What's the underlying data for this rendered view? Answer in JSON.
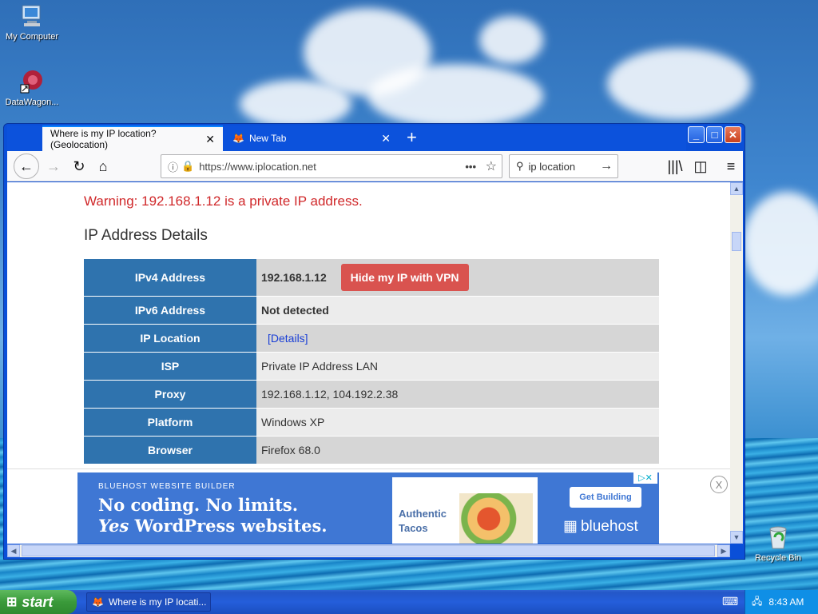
{
  "desktop": {
    "icons": [
      {
        "label": "My Computer"
      },
      {
        "label": "DataWagon..."
      },
      {
        "label": "Recycle Bin"
      }
    ]
  },
  "browser": {
    "tabs": [
      {
        "label": "Where is my IP location? (Geolocation)",
        "active": true
      },
      {
        "label": "New Tab",
        "active": false
      }
    ],
    "url": "https://www.iplocation.net",
    "search_value": "ip location"
  },
  "page": {
    "warning": "Warning: 192.168.1.12 is a private IP address.",
    "section_title": "IP Address Details",
    "rows": [
      {
        "key": "IPv4 Address",
        "value": "192.168.1.12"
      },
      {
        "key": "IPv6 Address",
        "value": "Not detected"
      },
      {
        "key": "IP Location",
        "value": "[Details]"
      },
      {
        "key": "ISP",
        "value": "Private IP Address LAN"
      },
      {
        "key": "Proxy",
        "value": "192.168.1.12, 104.192.2.38"
      },
      {
        "key": "Platform",
        "value": "Windows XP"
      },
      {
        "key": "Browser",
        "value": "Firefox 68.0"
      }
    ],
    "vpn_button": "Hide my IP with VPN"
  },
  "ad": {
    "eyebrow": "BLUEHOST WEBSITE BUILDER",
    "headline1": "No coding. No limits.",
    "headline2_em": "Yes",
    "headline2_rest": " WordPress websites.",
    "mock_text1": "Authentic",
    "mock_text2": "Tacos",
    "cta": "Get Building",
    "brand": "bluehost",
    "close": "X"
  },
  "taskbar": {
    "start": "start",
    "task_label": "Where is my IP locati...",
    "time": "8:43 AM"
  }
}
